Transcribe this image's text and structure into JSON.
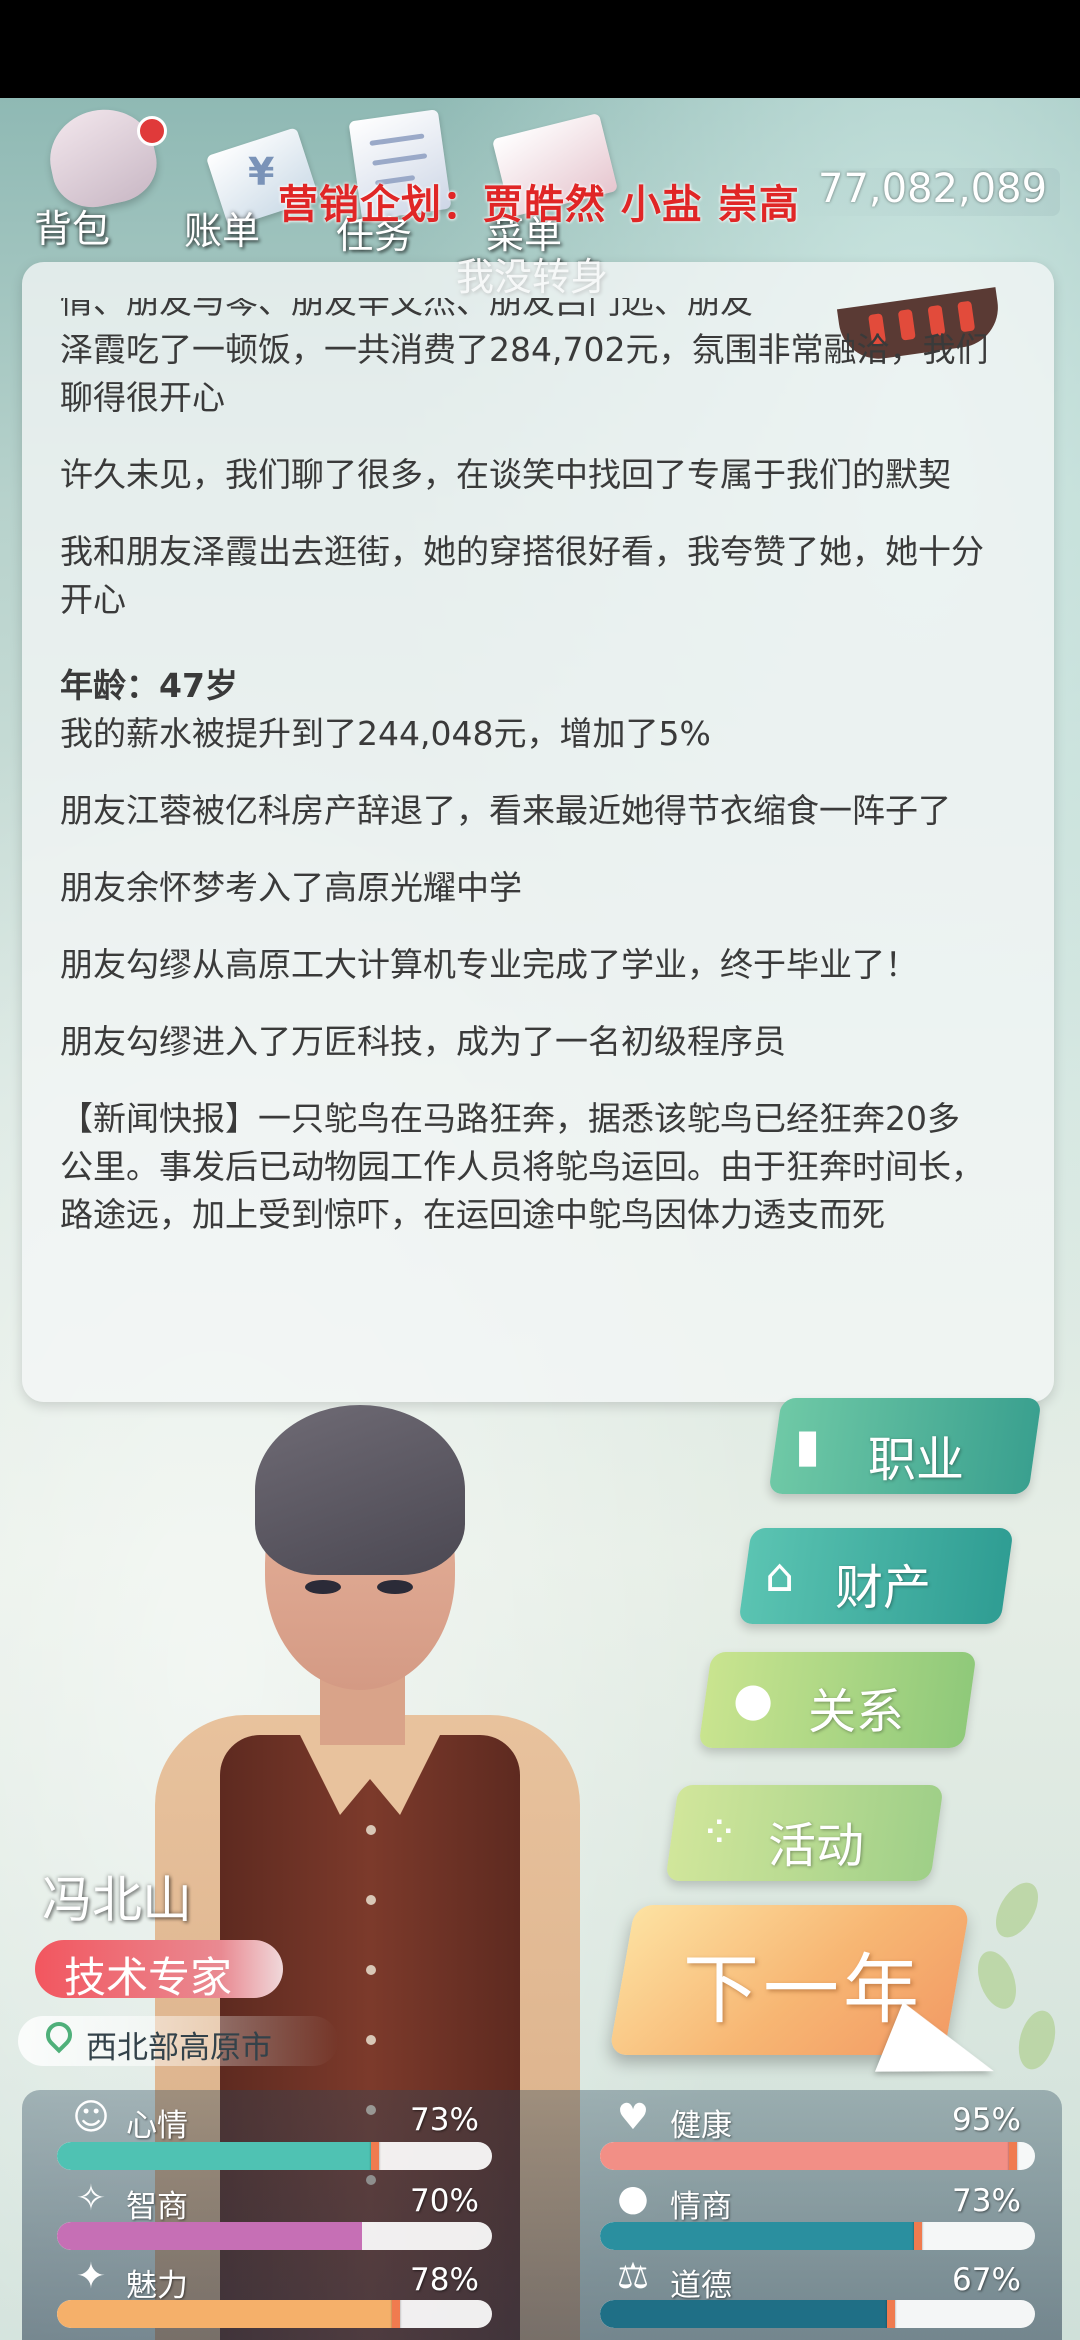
{
  "top_menu": [
    {
      "label": "背包"
    },
    {
      "label": "账单"
    },
    {
      "label": "任务"
    },
    {
      "label": "菜单"
    }
  ],
  "marketing_text": "营销企划：贾皓然 小盐 崇高",
  "money": "77,082,089",
  "streamer_text": "我没转身",
  "story": {
    "partial_top": "情、朋友与琴、朋友辛文杰、朋友吕门远、朋友",
    "lines": [
      "泽霞吃了一顿饭，一共消费了284,702元，氛围非常融洽，我们聊得很开心",
      "许久未见，我们聊了很多，在谈笑中找回了专属于我们的默契",
      "我和朋友泽霞出去逛街，她的穿搭很好看，我夸赞了她，她十分开心"
    ],
    "age_heading": "年龄：47岁",
    "age_lines": [
      "我的薪水被提升到了244,048元，增加了5%",
      "朋友江蓉被亿科房产辞退了，看来最近她得节衣缩食一阵子了",
      "朋友余怀梦考入了高原光耀中学",
      "朋友勾缪从高原工大计算机专业完成了学业，终于毕业了！",
      "朋友勾缪进入了万匠科技，成为了一名初级程序员",
      "【新闻快报】一只鸵鸟在马路狂奔，据悉该鸵鸟已经狂奔20多公里。事发后已动物园工作人员将鸵鸟运回。由于狂奔时间长，路途远，加上受到惊吓，在运回途中鸵鸟因体力透支而死"
    ]
  },
  "actions": {
    "career": "职业",
    "assets": "财产",
    "relations": "关系",
    "activities": "活动",
    "next_year": "下一年"
  },
  "character": {
    "name": "冯北山",
    "job": "技术专家",
    "location": "西北部高原市"
  },
  "stats": [
    {
      "key": "mood",
      "label": "心情",
      "value": "73%",
      "fill": 0.73,
      "color": "#4fc2b3",
      "icon": "smile-icon"
    },
    {
      "key": "iq",
      "label": "智商",
      "value": "70%",
      "fill": 0.7,
      "color": "#c66fb5",
      "icon": "lightbulb-icon"
    },
    {
      "key": "charm",
      "label": "魅力",
      "value": "78%",
      "fill": 0.78,
      "color": "#f5b06a",
      "icon": "sparkle-icon"
    },
    {
      "key": "health",
      "label": "健康",
      "value": "95%",
      "fill": 0.95,
      "color": "#f28f86",
      "icon": "heart-icon"
    },
    {
      "key": "eq",
      "label": "情商",
      "value": "73%",
      "fill": 0.73,
      "color": "#2a8f9f",
      "icon": "apple-icon"
    },
    {
      "key": "moral",
      "label": "道德",
      "value": "67%",
      "fill": 0.67,
      "color": "#1f6f86",
      "icon": "scale-icon"
    }
  ]
}
